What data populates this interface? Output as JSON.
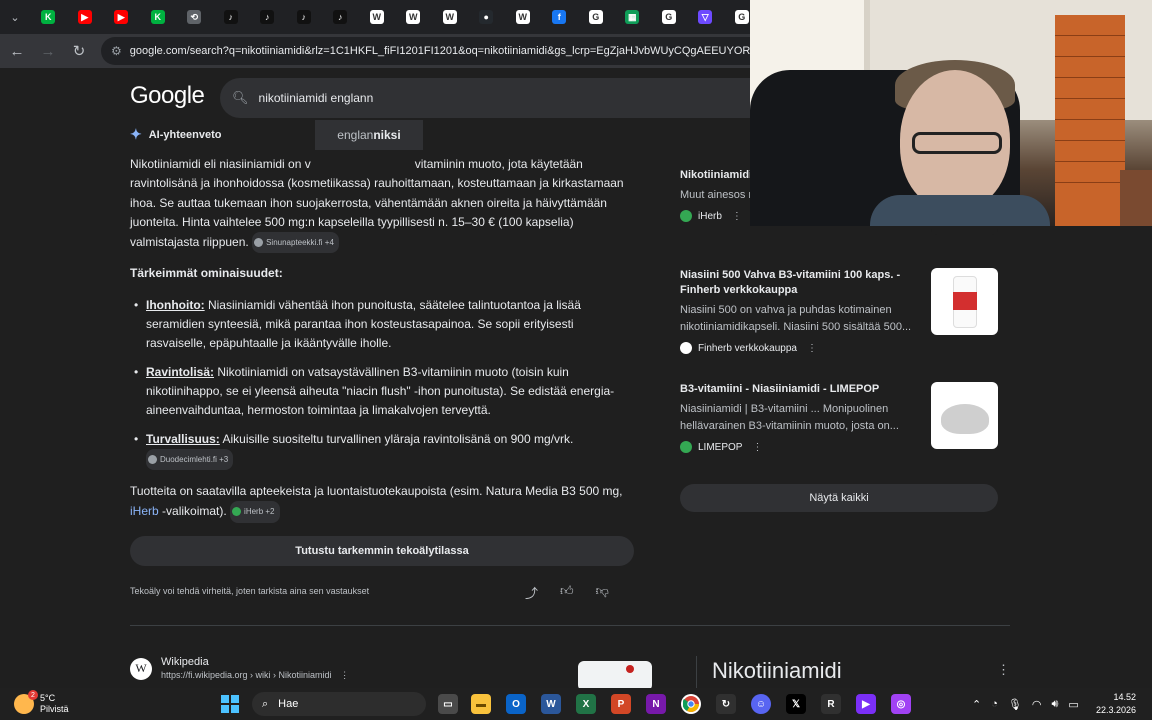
{
  "browser": {
    "url": "google.com/search?q=nikotiiniamidi&rlz=1C1HKFL_fiFI1201FI1201&oq=nikotiiniamidi&gs_lcrp=EgZjaHJvbWUyCQgAEEUYORi",
    "tabs": [
      {
        "icon": "k-icon",
        "glyph": "K",
        "color": "#00b140"
      },
      {
        "icon": "youtube-icon",
        "glyph": "▶",
        "color": "#ff0000"
      },
      {
        "icon": "youtube-icon",
        "glyph": "▶",
        "color": "#ff0000"
      },
      {
        "icon": "k-icon",
        "glyph": "K",
        "color": "#00b140"
      },
      {
        "icon": "history-icon",
        "glyph": "⟲",
        "color": "#5f6368"
      },
      {
        "icon": "tiktok-icon",
        "glyph": "♪",
        "color": "#111111"
      },
      {
        "icon": "tiktok-icon",
        "glyph": "♪",
        "color": "#111111"
      },
      {
        "icon": "tiktok-icon",
        "glyph": "♪",
        "color": "#111111"
      },
      {
        "icon": "tiktok-icon",
        "glyph": "♪",
        "color": "#111111"
      },
      {
        "icon": "wikipedia-icon",
        "glyph": "W",
        "color": "#ffffff"
      },
      {
        "icon": "wikipedia-icon",
        "glyph": "W",
        "color": "#ffffff"
      },
      {
        "icon": "wikipedia-icon",
        "glyph": "W",
        "color": "#ffffff"
      },
      {
        "icon": "github-icon",
        "glyph": "●",
        "color": "#24292e"
      },
      {
        "icon": "wikipedia-icon",
        "glyph": "W",
        "color": "#ffffff"
      },
      {
        "icon": "facebook-icon",
        "glyph": "f",
        "color": "#1877f2"
      },
      {
        "icon": "google-icon",
        "glyph": "G",
        "color": "#ffffff"
      },
      {
        "icon": "sheets-icon",
        "glyph": "▦",
        "color": "#0f9d58"
      },
      {
        "icon": "google-icon",
        "glyph": "G",
        "color": "#ffffff"
      },
      {
        "icon": "proton-icon",
        "glyph": "▽",
        "color": "#6d4aff"
      },
      {
        "icon": "google-icon",
        "glyph": "G",
        "color": "#ffffff"
      }
    ]
  },
  "google": {
    "logo": "Google",
    "query": "nikotiiniamidi englann",
    "suggestion_prefix": "englan",
    "suggestion_bold": "niksi"
  },
  "ai_overview": {
    "label": "AI-yhteenveto",
    "intro_visible": "Nikotiiniamidi eli niasiiniamidi on v",
    "intro_rest": "vitamiinin muoto, jota käytetään ravintolisänä ja ihonhoidossa (kosmetiikassa) rauhoittamaan, kosteuttamaan ja kirkastamaan ihoa. Se auttaa tukemaan ihon suojakerrosta, vähentämään aknen oireita ja häivyttämään juonteita. Hinta vaihtelee 500 mg:n kapseleilla tyypillisesti n. 15–30 € (100 kapselia) valmistajasta riippuen.",
    "intro_source": "Sinunapteekki.fi +4",
    "features_heading": "Tärkeimmät ominaisuudet:",
    "bullets": [
      {
        "title": "Ihonhoito:",
        "text": " Niasiiniamidi vähentää ihon punoitusta, säätelee talintuotantoa ja lisää seramidien synteesiä, mikä parantaa ihon kosteustasapainoa. Se sopii erityisesti rasvaiselle, epäpuhtaalle ja ikääntyvälle iholle.",
        "source": ""
      },
      {
        "title": "Ravintolisä:",
        "text": " Nikotiiniamidi on vatsaystävällinen B3-vitamiinin muoto (toisin kuin nikotiinihappo, se ei yleensä aiheuta \"niacin flush\" -ihon punoitusta). Se edistää energia-aineenvaihduntaa, hermoston toimintaa ja limakalvojen terveyttä.",
        "source": ""
      },
      {
        "title": "Turvallisuus:",
        "text": " Aikuisille suositeltu turvallinen yläraja ravintolisänä on 900 mg/vrk.",
        "source": "Duodecimlehti.fi +3"
      }
    ],
    "closing_before": "Tuotteita on saatavilla apteekeista ja luontaistuotekaupoista (esim. Natura Media B3 500 mg, ",
    "closing_link": "iHerb",
    "closing_after": " -valikoimat).",
    "closing_source": "iHerb +2",
    "deeper_button": "Tutustu tarkemmin tekoälytilassa",
    "disclaimer": "Tekoäly voi tehdä virheitä, joten tarkista aina sen vastaukset"
  },
  "sources": [
    {
      "title": "Nikotiiniamidi,",
      "desc": "Muut ainesos mg, 100 Veg C",
      "site": "iHerb",
      "icon_color": "#34a853"
    },
    {
      "title": "Niasiini 500 Vahva B3-vitamiini 100 kaps. - Finherb verkkokauppa",
      "desc": "Niasiini 500 on vahva ja puhdas kotimainen nikotiiniamidikapseli. Niasiini 500 sisältää 500...",
      "site": "Finherb verkkokauppa",
      "icon_color": "#ffffff"
    },
    {
      "title": "B3-vitamiini - Niasiiniamidi - LIMEPOP",
      "desc": "Niasiiniamidi | B3-vitamiini ... Monipuolinen hellävarainen B3-vitamiinin muoto, josta on...",
      "site": "LIMEPOP",
      "icon_color": "#34a853"
    }
  ],
  "show_all": "Näytä kaikki",
  "wiki_result": {
    "name": "Wikipedia",
    "url": "https://fi.wikipedia.org › wiki › Nikotiiniamidi",
    "knowledge_title": "Nikotiiniamidi"
  },
  "taskbar": {
    "temp": "5°C",
    "weather": "Pilvistä",
    "weather_badge": "2",
    "search": "Hae",
    "time": "14.52",
    "date": "22.3.2026"
  }
}
